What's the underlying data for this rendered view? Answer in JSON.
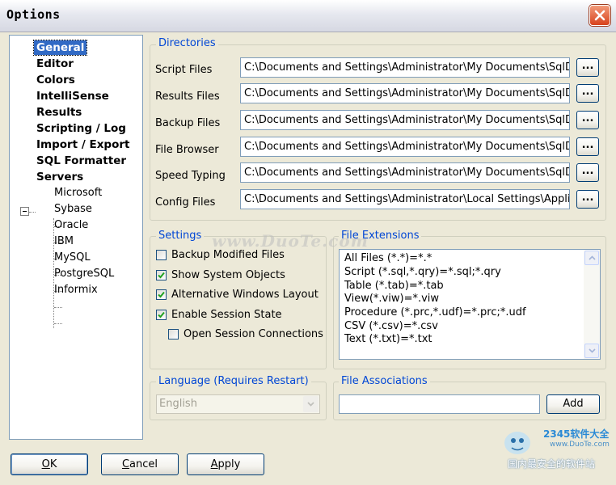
{
  "window": {
    "title": "Options"
  },
  "tree": {
    "items": [
      {
        "label": "General",
        "selected": true
      },
      {
        "label": "Editor"
      },
      {
        "label": "Colors"
      },
      {
        "label": "IntelliSense"
      },
      {
        "label": "Results"
      },
      {
        "label": "Scripting / Log"
      },
      {
        "label": "Import / Export"
      },
      {
        "label": "SQL Formatter"
      },
      {
        "label": "Servers"
      }
    ],
    "servers": [
      "Microsoft",
      "Sybase",
      "Oracle",
      "IBM",
      "MySQL",
      "PostgreSQL",
      "Informix"
    ]
  },
  "directories": {
    "legend": "Directories",
    "browse_label": "...",
    "rows": [
      {
        "label": "Script Files",
        "value": "C:\\Documents and Settings\\Administrator\\My Documents\\SqlDbx\\S"
      },
      {
        "label": "Results Files",
        "value": "C:\\Documents and Settings\\Administrator\\My Documents\\SqlDbx\\F"
      },
      {
        "label": "Backup Files",
        "value": "C:\\Documents and Settings\\Administrator\\My Documents\\SqlDbx\\E"
      },
      {
        "label": "File Browser",
        "value": "C:\\Documents and Settings\\Administrator\\My Documents\\SqlDbx\\T"
      },
      {
        "label": "Speed Typing",
        "value": "C:\\Documents and Settings\\Administrator\\My Documents\\SqlDbx\\S"
      },
      {
        "label": "Config Files",
        "value": "C:\\Documents and Settings\\Administrator\\Local Settings\\Applicatic"
      }
    ]
  },
  "settings": {
    "legend": "Settings",
    "options": [
      {
        "label": "Backup Modified Files",
        "checked": false
      },
      {
        "label": "Show System Objects",
        "checked": true
      },
      {
        "label": "Alternative Windows Layout",
        "checked": true
      },
      {
        "label": "Enable Session State",
        "checked": true
      },
      {
        "label": "Open Session Connections",
        "checked": false
      }
    ]
  },
  "file_extensions": {
    "legend": "File Extensions",
    "lines": [
      "All Files (*.*)=*.*",
      "Script (*.sql,*.qry)=*.sql;*.qry",
      "Table (*.tab)=*.tab",
      "View(*.viw)=*.viw",
      "Procedure (*.prc,*.udf)=*.prc;*.udf",
      "CSV (*.csv)=*.csv",
      "Text (*.txt)=*.txt"
    ]
  },
  "language": {
    "legend": "Language (Requires Restart)",
    "selected": "English"
  },
  "file_associations": {
    "legend": "File Associations",
    "input_value": "",
    "add_label": "Add"
  },
  "buttons": {
    "ok_mnemonic": "O",
    "ok_rest": "K",
    "cancel_mnemonic": "C",
    "cancel_rest": "ancel",
    "apply_mnemonic": "A",
    "apply_rest": "pply"
  },
  "watermark": {
    "site": "www.DuoTe.com",
    "brand": "2345软件大全",
    "url": "www.DuoTe.com",
    "slogan": "国内最安全的软件站"
  }
}
